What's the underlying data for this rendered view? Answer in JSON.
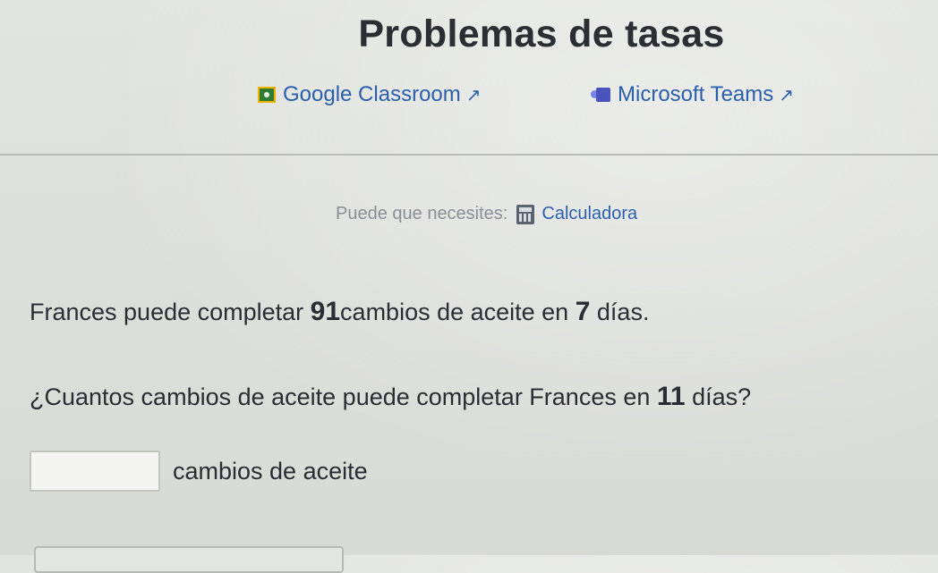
{
  "page": {
    "title": "Problemas de tasas"
  },
  "share": {
    "classroom_label": "Google Classroom",
    "teams_label": "Microsoft Teams",
    "classroom_icon": "google-classroom-icon",
    "teams_icon": "microsoft-teams-icon",
    "external_icon": "external-link-icon"
  },
  "tools": {
    "prefix": "Puede que necesites:",
    "calculator_label": "Calculadora",
    "calculator_icon": "calculator-icon"
  },
  "problem": {
    "text_before": "Frances puede completar ",
    "quantity": "91",
    "text_middle": "cambios de aceite en ",
    "days": "7",
    "text_after": " días."
  },
  "question": {
    "text_before": "¿Cuantos cambios de aceite puede completar Frances en ",
    "days": "11",
    "text_after": " días?"
  },
  "answer": {
    "value": "",
    "placeholder": "",
    "unit": "cambios de aceite"
  },
  "colors": {
    "link": "#2b5fae",
    "text": "#2a2d33",
    "muted": "#8a8e95",
    "background": "#dfe1dc"
  }
}
